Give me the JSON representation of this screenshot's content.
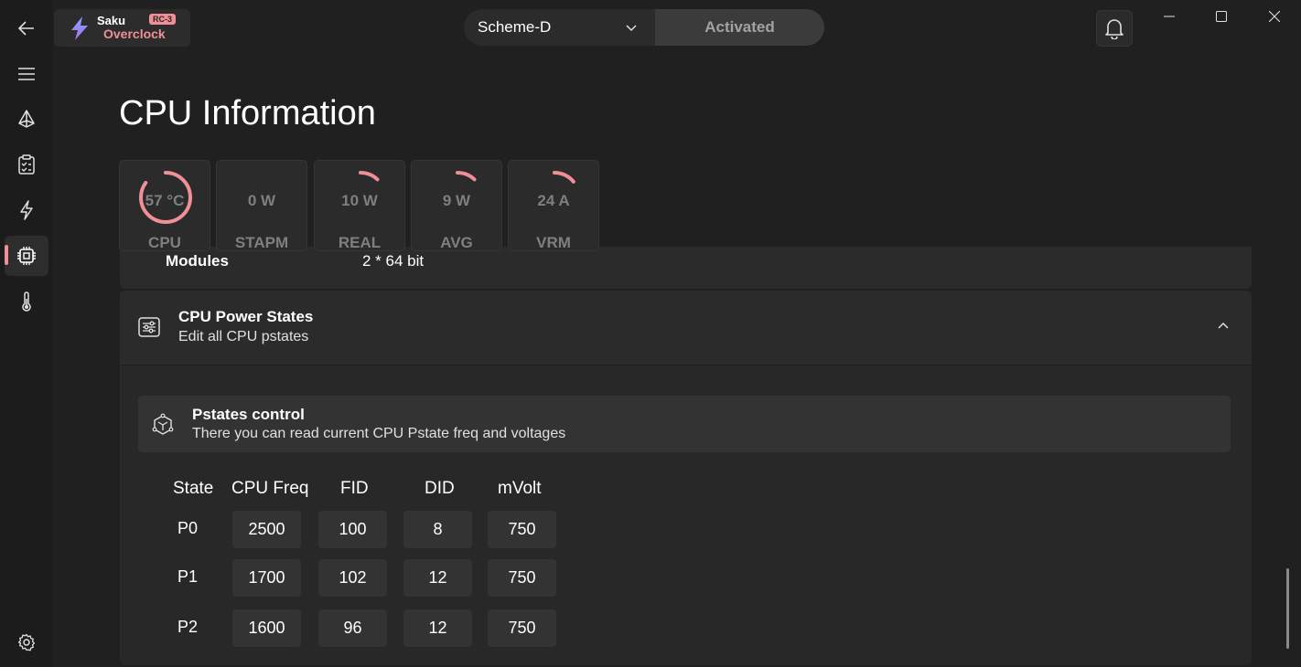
{
  "app": {
    "name_top": "Saku",
    "name_bottom": "Overclock",
    "badge": "RC-3",
    "accent_color": "#f08f96"
  },
  "header": {
    "scheme_selected": "Scheme-D",
    "activated_label": "Activated"
  },
  "sidebar": {
    "items": [
      {
        "icon": "back-arrow-icon"
      },
      {
        "icon": "hamburger-menu-icon"
      },
      {
        "icon": "prism-icon"
      },
      {
        "icon": "clipboard-icon"
      },
      {
        "icon": "lightning-icon"
      },
      {
        "icon": "cpu-chip-icon",
        "active": true
      },
      {
        "icon": "thermometer-icon"
      },
      {
        "icon": "settings-gear-icon"
      }
    ]
  },
  "page": {
    "title": "CPU Information"
  },
  "gauges": [
    {
      "value": "57 °C",
      "label": "CPU",
      "level": 0.85
    },
    {
      "value": "0 W",
      "label": "STAPM",
      "level": 0.0
    },
    {
      "value": "10 W",
      "label": "REAL",
      "level": 0.12
    },
    {
      "value": "9 W",
      "label": "AVG",
      "level": 0.12
    },
    {
      "value": "24 A",
      "label": "VRM",
      "level": 0.14
    }
  ],
  "modules": {
    "label": "Modules",
    "value": "2 * 64 bit"
  },
  "power_states": {
    "title": "CPU Power States",
    "subtitle": "Edit all CPU pstates",
    "pstates_card": {
      "title": "Pstates control",
      "subtitle": "There you can read current CPU Pstate freq and voltages"
    },
    "headers": {
      "state": "State",
      "freq": "CPU Freq",
      "fid": "FID",
      "did": "DID",
      "mvolt": "mVolt"
    },
    "rows": [
      {
        "state": "P0",
        "freq": "2500",
        "fid": "100",
        "did": "8",
        "mvolt": "750"
      },
      {
        "state": "P1",
        "freq": "1700",
        "fid": "102",
        "did": "12",
        "mvolt": "750"
      },
      {
        "state": "P2",
        "freq": "1600",
        "fid": "96",
        "did": "12",
        "mvolt": "750"
      }
    ]
  }
}
